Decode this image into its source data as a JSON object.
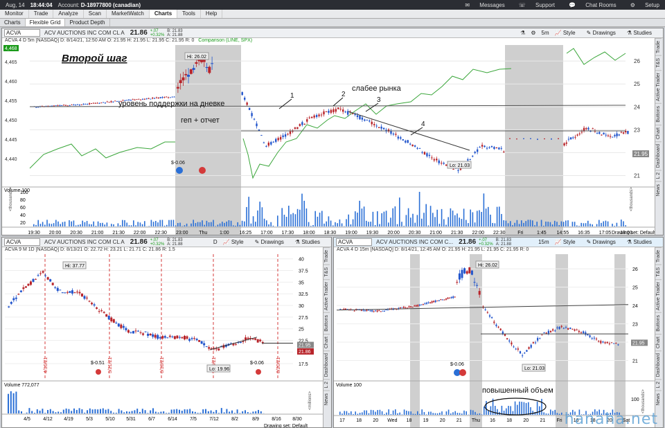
{
  "titlebar": {
    "date": "Aug, 14",
    "time": "18:44:04",
    "account_label": "Account:",
    "account": "D-18977800 (canadian)",
    "messages": "Messages",
    "support": "Support",
    "chat": "Chat Rooms",
    "setup": "Setup"
  },
  "menu": [
    "Monitor",
    "Trade",
    "Analyze",
    "Scan",
    "MarketWatch",
    "Charts",
    "Tools",
    "Help"
  ],
  "menu_active": 5,
  "subtabs": [
    "Charts",
    "Flexible Grid",
    "Product Depth"
  ],
  "subtab_active": 1,
  "side_tabs": [
    "Trade",
    "T&S",
    "Active Trader",
    "Buttons",
    "Chart",
    "Dashboard",
    "L 2",
    "News"
  ],
  "top": {
    "symbol": "ACVA",
    "desc": "ACV AUCTIONS INC COM CL A",
    "price": "21.86",
    "chg1": "+.07",
    "chg2": "+0.32%",
    "bid": "B: 21.83",
    "ask": "A: 21.88",
    "tf": "5m",
    "style": "Style",
    "drawings": "Drawings",
    "studies": "Studies",
    "ohlc": "ACVA 4 D 5m [NASDAQ]   D: 8/14/21, 12:50 AM   O: 21.95   H: 21.95   L: 21.95   C: 21.95   R: 0",
    "comparison": "Comparison (LINE, SPX)",
    "y_left": [
      "4,465",
      "4,460",
      "4,455",
      "4,450",
      "4,445",
      "4,440"
    ],
    "y_left_tag": "4,468",
    "y_right": [
      "26",
      "25",
      "24",
      "23",
      "22",
      "21"
    ],
    "y_right_tag": "21.95",
    "x_labels": [
      "19:30",
      "20:00",
      "20:30",
      "21:00",
      "21:30",
      "22:00",
      "22:30",
      "23:00",
      "Thu",
      "1:00",
      "16:25",
      "17:00",
      "17:30",
      "18:00",
      "18:30",
      "19:00",
      "19:30",
      "20:00",
      "20:30",
      "21:00",
      "21:30",
      "22:00",
      "22:30",
      "Fri",
      "1:45",
      "14:55",
      "16:35",
      "17:05",
      "18:00"
    ],
    "hi": "Hi: 26.02",
    "lo": "Lo: 21.03",
    "annot_title": "Второй шаг",
    "annot_support": "уровень поддержки на дневке",
    "annot_gap": "геп + отчет",
    "annot_weaker": "слабее рынка",
    "n1": "1",
    "n2": "2",
    "n3": "3",
    "n4": "4",
    "earnings": "$-0.06",
    "volume_label": "Volume",
    "volume_val": "100",
    "vol_axis": [
      "100",
      "80",
      "60",
      "40",
      "20"
    ],
    "vol_unit": "<thousands>",
    "drawing_set": "Drawing set: Default"
  },
  "bl": {
    "symbol": "ACVA",
    "desc": "ACV AUCTIONS INC COM CL A",
    "price": "21.86",
    "chg1": "+.07",
    "chg2": "+0.32%",
    "bid": "B: 21.83",
    "ask": "A: 21.88",
    "tf": "D",
    "style": "Style",
    "drawings": "Drawings",
    "studies": "Studies",
    "ohlc": "ACVA 9 M 1D [NASDAQ]   D: 8/13/21   O: 22.72   H: 23.21   L: 21.71   C: 21.86   R: 1.5",
    "y_right": [
      "40",
      "37.5",
      "35",
      "32.5",
      "30",
      "27.5",
      "25",
      "22.5",
      "20",
      "17.5"
    ],
    "tag1": "21.95",
    "tag2": "21.86",
    "hi": "Hi: 37.77",
    "lo": "Lo: 19.96",
    "earn1": "$-0.51",
    "earn2": "$-0.06",
    "dates_v": [
      "4/16/21",
      "5/21/21",
      "6/18/21",
      "7/16/21",
      "8/20/21"
    ],
    "x_labels": [
      "4/5",
      "4/12",
      "4/19",
      "5/3",
      "5/10",
      "5/31",
      "6/7",
      "6/14",
      "7/5",
      "7/12",
      "8/2",
      "8/9",
      "8/16",
      "8/30"
    ],
    "volume_label": "Volume",
    "volume_val": "772,077",
    "vol_unit": "<millions>",
    "drawing_set": "Drawing set: Default"
  },
  "br": {
    "symbol": "ACVA",
    "desc": "ACV AUCTIONS INC COM C...",
    "price": "21.86",
    "chg1": "+.07",
    "chg2": "+0.32%",
    "bid": "B: 21.83",
    "ask": "A: 21.88",
    "tf": "15m",
    "style": "Style",
    "drawings": "Drawings",
    "studies": "Studies",
    "ohlc": "ACVA 4 D 15m [NASDAQ]   D: 8/14/21, 12:45 AM   O: 21.95   H: 21.95   L: 21.95   C: 21.95   R: 0",
    "y_right": [
      "26",
      "25",
      "24",
      "23",
      "22",
      "21"
    ],
    "tag": "21.95",
    "hi": "Hi: 26.02",
    "lo": "Lo: 21.03",
    "earn": "$-0.06",
    "annot_volume": "повышенный объем",
    "x_labels": [
      "17",
      "18",
      "20",
      "Wed",
      "18",
      "19",
      "20",
      "21",
      "Thu",
      "16",
      "18",
      "20",
      "21",
      "Fri",
      "16",
      "18",
      "20",
      "Sat"
    ],
    "volume_label": "Volume",
    "volume_val": "100",
    "vol_axis": [
      "100"
    ],
    "vol_unit": "<thousands>"
  },
  "watermark": "hanaha.net"
}
